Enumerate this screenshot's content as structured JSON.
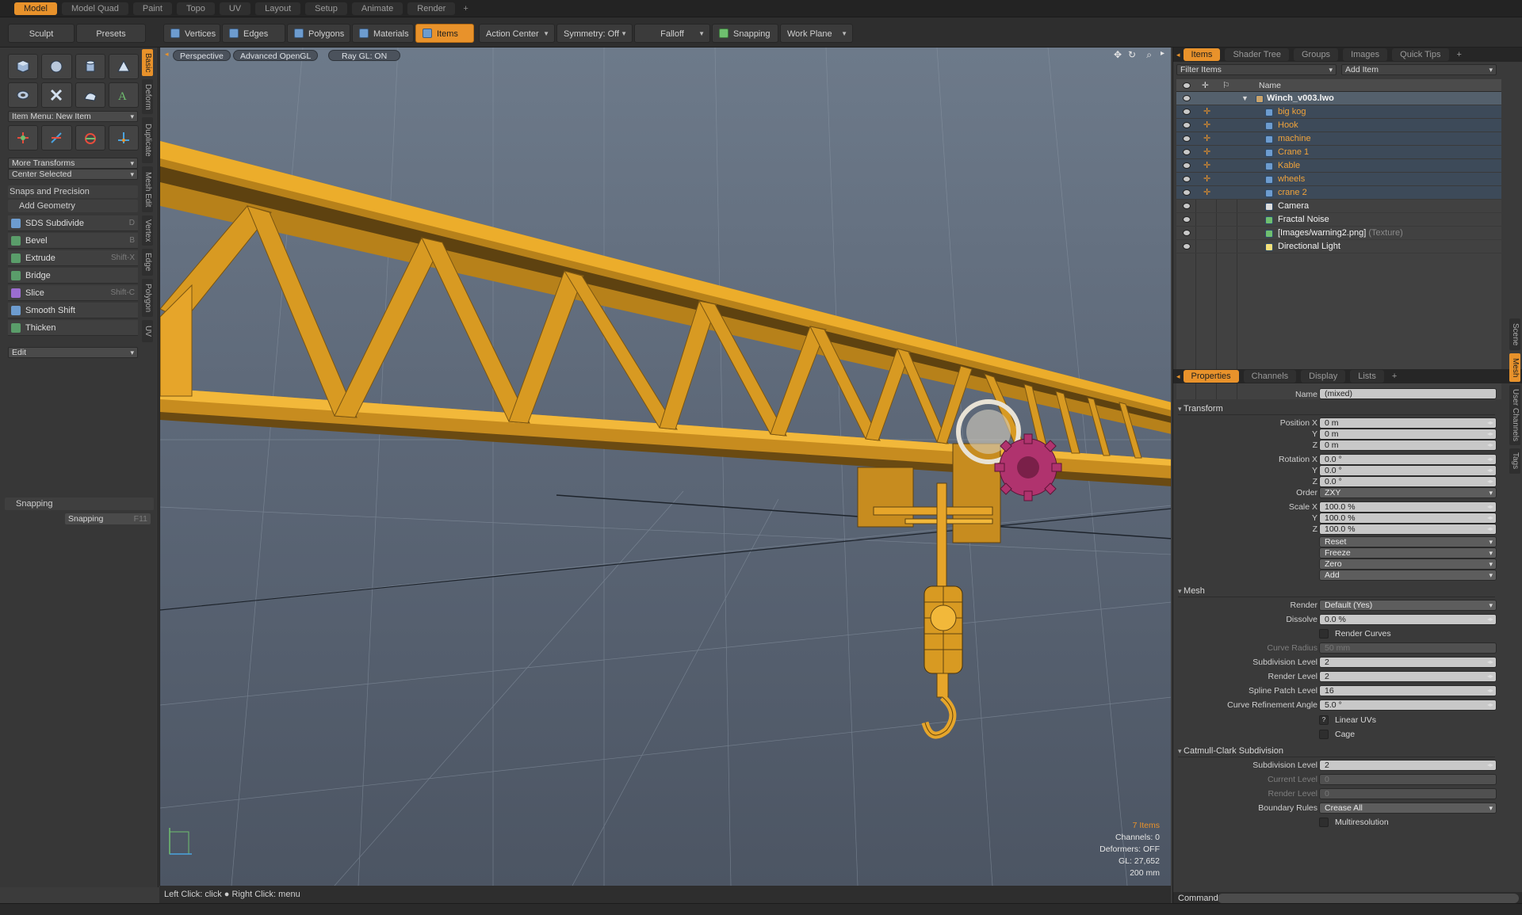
{
  "top_tabs": [
    "Model",
    "Model Quad",
    "Paint",
    "Topo",
    "UV",
    "Layout",
    "Setup",
    "Animate",
    "Render",
    "+"
  ],
  "toolbar": {
    "sculpt": "Sculpt",
    "presets": "Presets",
    "vertices": "Vertices",
    "edges": "Edges",
    "polygons": "Polygons",
    "materials": "Materials",
    "items": "Items",
    "action_center": "Action Center",
    "symmetry": "Symmetry: Off",
    "falloff": "Falloff",
    "snapping": "Snapping",
    "work_plane": "Work Plane"
  },
  "left": {
    "item_menu": "Item Menu: New Item",
    "more_transforms": "More Transforms",
    "center_selected": "Center Selected",
    "snaps_precision": "Snaps and Precision",
    "add_geometry": "Add Geometry",
    "tools": [
      {
        "label": "SDS Subdivide",
        "shortcut": "D"
      },
      {
        "label": "Bevel",
        "shortcut": "B"
      },
      {
        "label": "Extrude",
        "shortcut": "Shift-X"
      },
      {
        "label": "Bridge",
        "shortcut": ""
      },
      {
        "label": "Slice",
        "shortcut": "Shift-C"
      },
      {
        "label": "Smooth Shift",
        "shortcut": ""
      },
      {
        "label": "Thicken",
        "shortcut": ""
      }
    ],
    "edit": "Edit",
    "snapping_section": "Snapping",
    "snapping_button": "Snapping",
    "snapping_key": "F11",
    "side_tabs": [
      "Basic",
      "Deform",
      "Duplicate",
      "Mesh Edit",
      "Vertex",
      "Edge",
      "Polygon",
      "UV"
    ]
  },
  "viewport": {
    "perspective": "Perspective",
    "render_mode": "Advanced OpenGL",
    "raygl": "Ray GL: ON",
    "info": {
      "items": "7 Items",
      "channels": "Channels: 0",
      "deformers": "Deformers: OFF",
      "gl": "GL: 27,652",
      "size": "200 mm"
    }
  },
  "status": {
    "hint": "Left Click: click  ●  Right Click: menu"
  },
  "items_panel": {
    "tabs": [
      "Items",
      "Shader Tree",
      "Groups",
      "Images",
      "Quick Tips",
      "+"
    ],
    "filter": "Filter Items",
    "add_item": "Add Item",
    "name_header": "Name",
    "root": "Winch_v003.lwo",
    "meshes": [
      "big kog",
      "Hook",
      "machine",
      "Crane 1",
      "Kable",
      "wheels",
      "crane 2"
    ],
    "others": [
      {
        "name": "Camera",
        "tag": ""
      },
      {
        "name": "Fractal Noise",
        "tag": ""
      },
      {
        "name": "[Images/warning2.png]",
        "tag": "(Texture)"
      },
      {
        "name": "Directional Light",
        "tag": ""
      }
    ]
  },
  "properties": {
    "tabs": [
      "Properties",
      "Channels",
      "Display",
      "Lists",
      "+"
    ],
    "name_label": "Name",
    "name_value": "(mixed)",
    "transform": "Transform",
    "position_x": "Position X",
    "y": "Y",
    "z": "Z",
    "pos_values": [
      "0 m",
      "0 m",
      "0 m"
    ],
    "rotation_x": "Rotation X",
    "rot_values": [
      "0.0 °",
      "0.0 °",
      "0.0 °"
    ],
    "order_label": "Order",
    "order_value": "ZXY",
    "scale_x": "Scale X",
    "scale_values": [
      "100.0 %",
      "100.0 %",
      "100.0 %"
    ],
    "actions": [
      "Reset",
      "Freeze",
      "Zero",
      "Add"
    ],
    "mesh": "Mesh",
    "render_label": "Render",
    "render_value": "Default (Yes)",
    "dissolve_label": "Dissolve",
    "dissolve_value": "0.0 %",
    "render_curves": "Render Curves",
    "curve_radius_label": "Curve Radius",
    "curve_radius_value": "50 mm",
    "subdiv_label": "Subdivision Level",
    "subdiv_value": "2",
    "render_level_label": "Render Level",
    "render_level_value": "2",
    "spline_label": "Spline Patch Level",
    "spline_value": "16",
    "curve_ref_label": "Curve Refinement Angle",
    "curve_ref_value": "5.0 °",
    "linear_uvs": "Linear UVs",
    "linear_uvs_key": "?",
    "cage": "Cage",
    "catmull": "Catmull-Clark Subdivision",
    "cc_subdiv_label": "Subdivision Level",
    "cc_subdiv_value": "2",
    "cc_current_label": "Current Level",
    "cc_current_value": "0",
    "cc_render_label": "Render Level",
    "cc_render_value": "0",
    "boundary_label": "Boundary Rules",
    "boundary_value": "Crease All",
    "multires": "Multiresolution",
    "side_tabs": [
      "Scene",
      "Mesh",
      "User Channels",
      "Tags"
    ]
  },
  "command": {
    "label": "Command"
  },
  "colors": {
    "accent": "#e8922b",
    "truss": "#d99a1e",
    "gear": "#b0336e",
    "viewport_top": "#6d7a8a"
  }
}
